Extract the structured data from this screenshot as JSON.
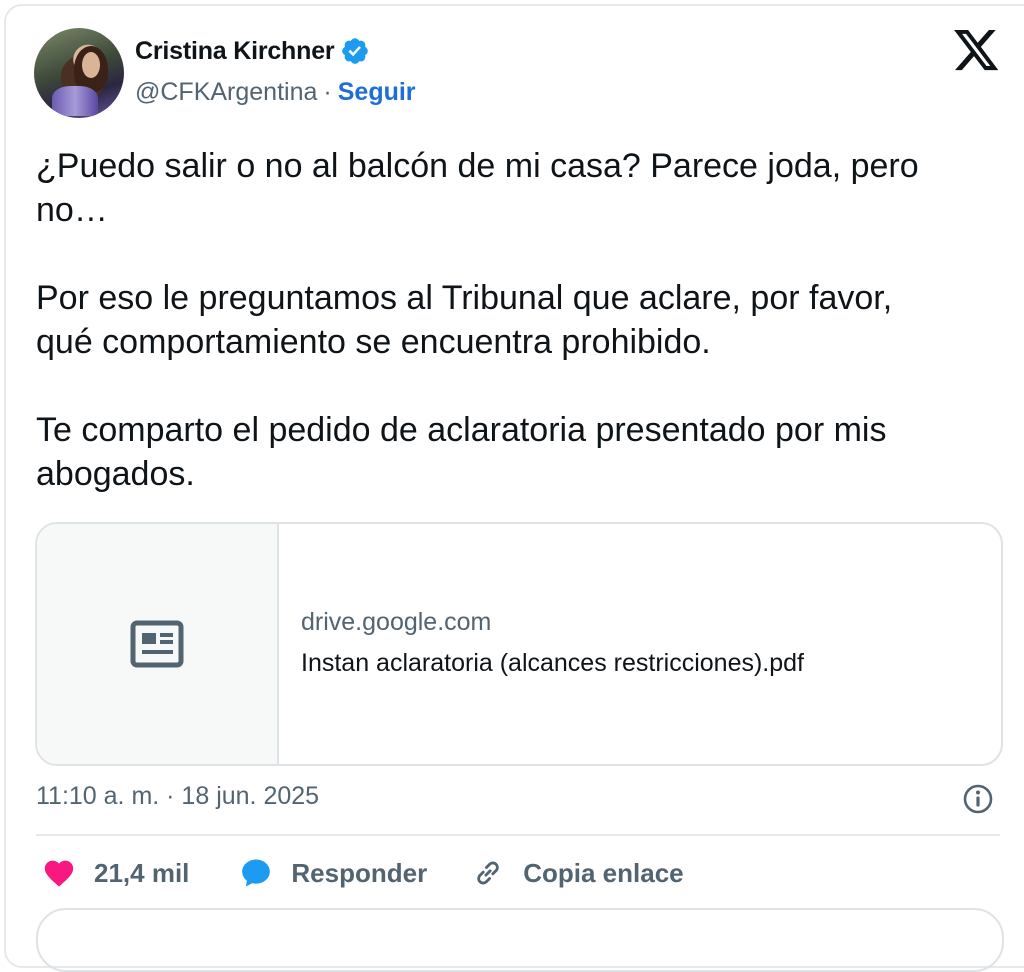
{
  "author": {
    "display_name": "Cristina Kirchner",
    "handle": "@CFKArgentina",
    "separator": "·",
    "follow_label": "Seguir",
    "verified_color": "#1d9bf0"
  },
  "tweet": {
    "text": "¿Puedo salir o no al balcón de mi casa? Parece joda, pero\nno…\n\nPor eso le preguntamos al Tribunal que aclare, por favor,\nqué comportamiento se encuentra prohibido.\n\nTe comparto el pedido de aclaratoria presentado por mis\nabogados."
  },
  "link_card": {
    "domain": "drive.google.com",
    "title": "Instan aclaratoria (alcances restricciones).pdf",
    "icon": "article-icon"
  },
  "meta": {
    "timestamp": "11:10 a. m. · 18 jun. 2025"
  },
  "actions": {
    "likes": "21,4 mil",
    "reply_label": "Responder",
    "copy_link_label": "Copia enlace",
    "like_color": "#f91880",
    "reply_color": "#1d9bf0"
  },
  "brand": {
    "logo": "x-logo"
  }
}
